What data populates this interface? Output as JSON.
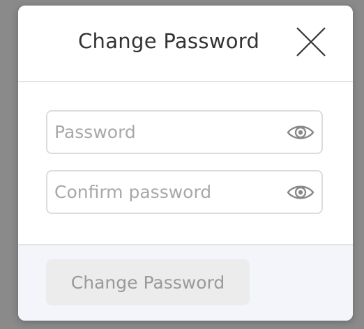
{
  "modal": {
    "title": "Change Password",
    "close_icon": "close-icon"
  },
  "form": {
    "password": {
      "value": "",
      "placeholder": "Password",
      "toggle_icon": "eye-icon"
    },
    "confirm_password": {
      "value": "",
      "placeholder": "Confirm password",
      "toggle_icon": "eye-icon"
    }
  },
  "footer": {
    "submit_label": "Change Password",
    "submit_disabled": true
  },
  "colors": {
    "overlay": "#8a8a8a",
    "footer_bg": "#f3f5fa",
    "button_disabled_bg": "#ececec",
    "button_disabled_text": "#9a9a9a"
  }
}
